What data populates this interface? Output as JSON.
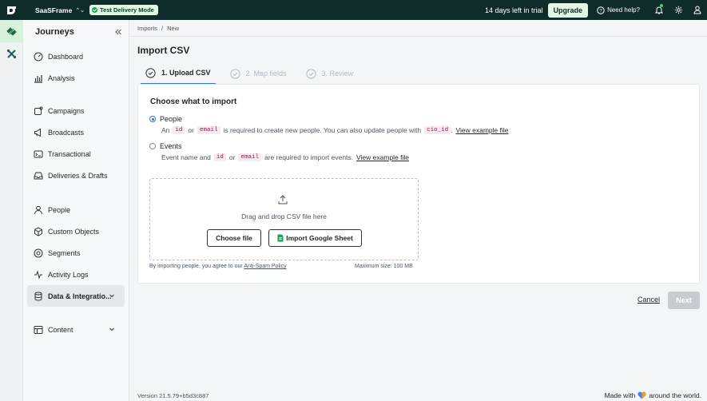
{
  "topbar": {
    "workspace": "SaaSFrame",
    "mode_badge": "Test Delivery Mode",
    "trial_text": "14 days left in trial",
    "upgrade_label": "Upgrade",
    "help_label": "Need help?"
  },
  "sidebar": {
    "title": "Journeys",
    "items": [
      {
        "label": "Dashboard",
        "icon": "dashboard-icon"
      },
      {
        "label": "Analysis",
        "icon": "analysis-icon"
      },
      {
        "label": "Campaigns",
        "icon": "campaigns-icon"
      },
      {
        "label": "Broadcasts",
        "icon": "broadcasts-icon"
      },
      {
        "label": "Transactional",
        "icon": "transactional-icon"
      },
      {
        "label": "Deliveries & Drafts",
        "icon": "deliveries-icon"
      },
      {
        "label": "People",
        "icon": "people-icon"
      },
      {
        "label": "Custom Objects",
        "icon": "custom-objects-icon"
      },
      {
        "label": "Segments",
        "icon": "segments-icon"
      },
      {
        "label": "Activity Logs",
        "icon": "activity-logs-icon"
      },
      {
        "label": "Data & Integrations",
        "display": "Data & Integratio...",
        "icon": "database-icon",
        "active": true
      },
      {
        "label": "Content",
        "icon": "content-icon"
      }
    ]
  },
  "breadcrumb": {
    "parent": "Imports",
    "separator": "/",
    "current": "New"
  },
  "page_title": "Import CSV",
  "steps": [
    {
      "label": "1. Upload CSV",
      "active": true
    },
    {
      "label": "2. Map fields",
      "active": false
    },
    {
      "label": "3. Review",
      "active": false
    }
  ],
  "import": {
    "heading": "Choose what to import",
    "people": {
      "label": "People",
      "selected": true,
      "desc_1": "An",
      "code_id": "id",
      "or": "or",
      "code_email": "email",
      "desc_2": "is required to create new people. You can also update people with",
      "code_cio": "cio_id",
      "dot": ".",
      "link": "View example file"
    },
    "events": {
      "label": "Events",
      "selected": false,
      "desc_1": "Event name and",
      "code_id": "id",
      "or": "or",
      "code_email": "email",
      "desc_2": "are required to import events.",
      "link": "View example file"
    },
    "dropzone_text": "Drag and drop CSV file here",
    "choose_file": "Choose file",
    "import_sheet": "Import Google Sheet",
    "agree_text": "By importing people, you agree to our",
    "agree_link": "Anti-Spam Policy",
    "max_size": "Maximum size: 100 MB"
  },
  "footer_actions": {
    "cancel": "Cancel",
    "next": "Next"
  },
  "footer": {
    "version": "Version 21.5.79+b5d3c887",
    "made_prefix": "Made with",
    "made_suffix": "around the world."
  },
  "colors": {
    "topbar": "#0f2b2a",
    "accent": "#2e78c7",
    "badge": "#dff7e4",
    "code_text": "#8a1c4a"
  }
}
